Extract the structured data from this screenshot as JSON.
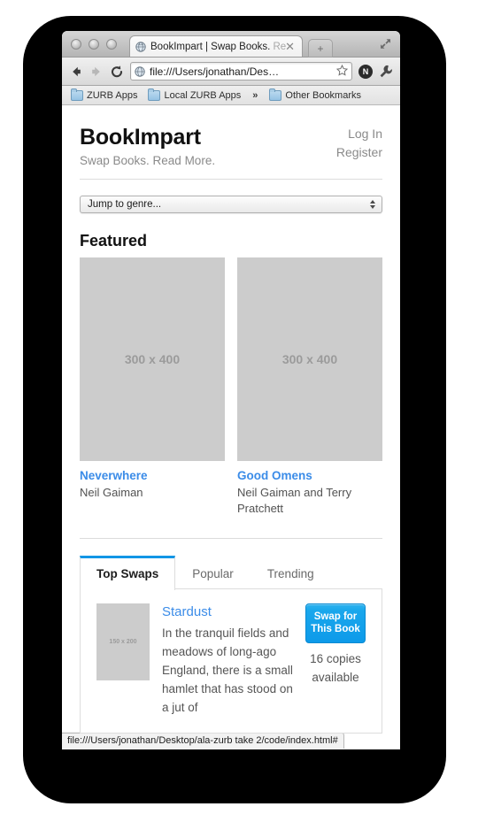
{
  "browser": {
    "traffic_lights": [
      "close",
      "minimize",
      "zoom"
    ],
    "tab": {
      "title_main": "BookImpart | Swap Books. ",
      "title_fade": "Re",
      "close_glyph": "✕",
      "favicon": "globe-icon"
    },
    "new_tab_glyph": "+",
    "fullscreen_icon": "fullscreen-arrows-icon",
    "toolbar": {
      "back_glyph": "←",
      "forward_glyph": "→",
      "reload_glyph": "C",
      "url": "file:///Users/jonathan/Des…",
      "star_glyph": "☆",
      "extension_badge": "N",
      "menu_icon": "wrench-icon"
    },
    "bookmarks": [
      {
        "label": "ZURB Apps",
        "icon": "folder-icon"
      },
      {
        "label": "Local ZURB Apps",
        "icon": "folder-icon"
      },
      {
        "label": "»",
        "icon": "overflow-chevron-icon"
      },
      {
        "label": "Other Bookmarks",
        "icon": "folder-icon"
      }
    ]
  },
  "status": {
    "url": "file:///Users/jonathan/Desktop/ala-zurb take 2/code/index.html#"
  },
  "site": {
    "brand": "BookImpart",
    "tagline": "Swap Books. Read More.",
    "account": [
      {
        "label": "Log In"
      },
      {
        "label": "Register"
      }
    ],
    "genre_select": {
      "value": "Jump to genre...",
      "icon": "select-stepper-icon"
    },
    "featured": {
      "heading": "Featured",
      "items": [
        {
          "placeholder": "300 x 400",
          "title": "Neverwhere",
          "author": "Neil Gaiman"
        },
        {
          "placeholder": "300 x 400",
          "title": "Good Omens",
          "author": "Neil Gaiman and Terry Pratchett"
        }
      ]
    },
    "tabs": {
      "items": [
        {
          "label": "Top Swaps",
          "active": true
        },
        {
          "label": "Popular",
          "active": false
        },
        {
          "label": "Trending",
          "active": false
        }
      ],
      "panel": {
        "thumb_placeholder": "150 x 200",
        "title": "Stardust",
        "description": "In the tranquil fields and meadows of long-ago England, there is a small hamlet that has stood on a jut of",
        "swap_button": "Swap for This Book",
        "copies": "16 copies available"
      }
    }
  },
  "colors": {
    "link_blue": "#3b8ce8",
    "accent_blue": "#1296e6",
    "button_blue": "#0d9ae9",
    "placeholder_gray": "#cccccc",
    "frame_black": "#000000"
  }
}
